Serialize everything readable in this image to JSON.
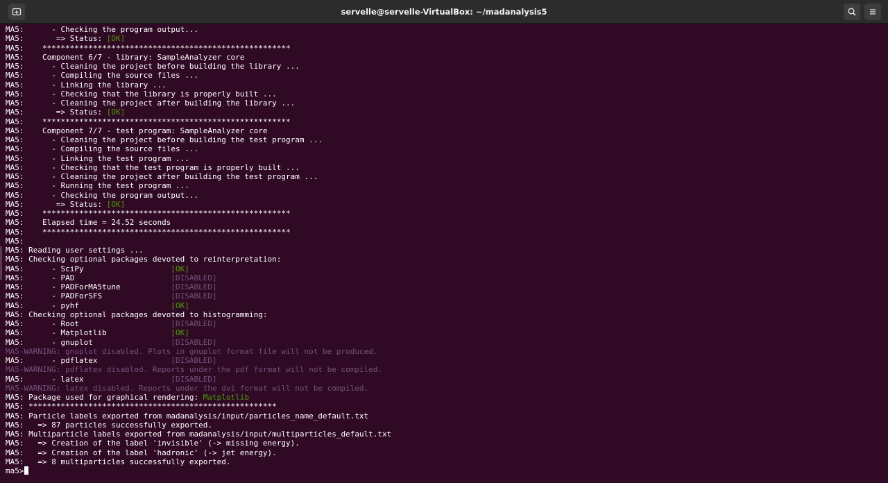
{
  "window": {
    "title": "servelle@servelle-VirtualBox: ~/madanalysis5",
    "new_tab_icon": "new-tab-icon",
    "search_icon": "search-icon",
    "menu_icon": "hamburger-menu-icon"
  },
  "colors": {
    "background": "#300a24",
    "text": "#ffffff",
    "ok": "#4e9a06",
    "disabled": "#75507b",
    "titlebar": "#2c2c2c"
  },
  "terminal": {
    "prompt": "ma5>",
    "lines": [
      [
        {
          "t": "MA5:      - Checking the program output..."
        }
      ],
      [
        {
          "t": "MA5:       => Status: "
        },
        {
          "t": "[OK]",
          "c": "ok"
        }
      ],
      [
        {
          "t": "MA5:    ******************************************************"
        }
      ],
      [
        {
          "t": "MA5:    Component 6/7 - library: SampleAnalyzer core"
        }
      ],
      [
        {
          "t": "MA5:      - Cleaning the project before building the library ..."
        }
      ],
      [
        {
          "t": "MA5:      - Compiling the source files ..."
        }
      ],
      [
        {
          "t": "MA5:      - Linking the library ..."
        }
      ],
      [
        {
          "t": "MA5:      - Checking that the library is properly built ..."
        }
      ],
      [
        {
          "t": "MA5:      - Cleaning the project after building the library ..."
        }
      ],
      [
        {
          "t": "MA5:       => Status: "
        },
        {
          "t": "[OK]",
          "c": "ok"
        }
      ],
      [
        {
          "t": "MA5:    ******************************************************"
        }
      ],
      [
        {
          "t": "MA5:    Component 7/7 - test program: SampleAnalyzer core"
        }
      ],
      [
        {
          "t": "MA5:      - Cleaning the project before building the test program ..."
        }
      ],
      [
        {
          "t": "MA5:      - Compiling the source files ..."
        }
      ],
      [
        {
          "t": "MA5:      - Linking the test program ..."
        }
      ],
      [
        {
          "t": "MA5:      - Checking that the test program is properly built ..."
        }
      ],
      [
        {
          "t": "MA5:      - Cleaning the project after building the test program ..."
        }
      ],
      [
        {
          "t": "MA5:      - Running the test program ..."
        }
      ],
      [
        {
          "t": "MA5:      - Checking the program output..."
        }
      ],
      [
        {
          "t": "MA5:       => Status: "
        },
        {
          "t": "[OK]",
          "c": "ok"
        }
      ],
      [
        {
          "t": "MA5:    ******************************************************"
        }
      ],
      [
        {
          "t": "MA5:    Elapsed time = 24.52 seconds"
        }
      ],
      [
        {
          "t": "MA5:    ******************************************************"
        }
      ],
      [
        {
          "t": "MA5:"
        }
      ],
      [
        {
          "t": "MA5: Reading user settings ..."
        }
      ],
      [
        {
          "t": "MA5: Checking optional packages devoted to reinterpretation:"
        }
      ],
      [
        {
          "t": "MA5:      - SciPy                   "
        },
        {
          "t": "[OK]",
          "c": "ok"
        }
      ],
      [
        {
          "t": "MA5:      - PAD                     "
        },
        {
          "t": "[DISABLED]",
          "c": "dis"
        }
      ],
      [
        {
          "t": "MA5:      - PADForMA5tune           "
        },
        {
          "t": "[DISABLED]",
          "c": "dis"
        }
      ],
      [
        {
          "t": "MA5:      - PADForSFS               "
        },
        {
          "t": "[DISABLED]",
          "c": "dis"
        }
      ],
      [
        {
          "t": "MA5:      - pyhf                    "
        },
        {
          "t": "[OK]",
          "c": "ok"
        }
      ],
      [
        {
          "t": "MA5: Checking optional packages devoted to histogramming:"
        }
      ],
      [
        {
          "t": "MA5:      - Root                    "
        },
        {
          "t": "[DISABLED]",
          "c": "dis"
        }
      ],
      [
        {
          "t": "MA5:      - Matplotlib              "
        },
        {
          "t": "[OK]",
          "c": "ok"
        }
      ],
      [
        {
          "t": "MA5:      - gnuplot                 "
        },
        {
          "t": "[DISABLED]",
          "c": "dis"
        }
      ],
      [
        {
          "t": "MA5-WARNING: gnuplot disabled. Plots in gnuplot format file will not be produced.",
          "c": "warn"
        }
      ],
      [
        {
          "t": "MA5:      - pdflatex                "
        },
        {
          "t": "[DISABLED]",
          "c": "dis"
        }
      ],
      [
        {
          "t": "MA5-WARNING: pdflatex disabled. Reports under the pdf format will not be compiled.",
          "c": "warn"
        }
      ],
      [
        {
          "t": "MA5:      - latex                   "
        },
        {
          "t": "[DISABLED]",
          "c": "dis"
        }
      ],
      [
        {
          "t": "MA5-WARNING: latex disabled. Reports under the dvi format will not be compiled.",
          "c": "warn"
        }
      ],
      [
        {
          "t": "MA5: Package used for graphical rendering: "
        },
        {
          "t": "Matplotlib",
          "c": "ok"
        }
      ],
      [
        {
          "t": "MA5: ******************************************************"
        }
      ],
      [
        {
          "t": "MA5: Particle labels exported from madanalysis/input/particles_name_default.txt"
        }
      ],
      [
        {
          "t": "MA5:   => 87 particles successfully exported."
        }
      ],
      [
        {
          "t": "MA5: Multiparticle labels exported from madanalysis/input/multiparticles_default.txt"
        }
      ],
      [
        {
          "t": "MA5:   => Creation of the label 'invisible' (-> missing energy)."
        }
      ],
      [
        {
          "t": "MA5:   => Creation of the label 'hadronic' (-> jet energy)."
        }
      ],
      [
        {
          "t": "MA5:   => 8 multiparticles successfully exported."
        }
      ]
    ]
  }
}
